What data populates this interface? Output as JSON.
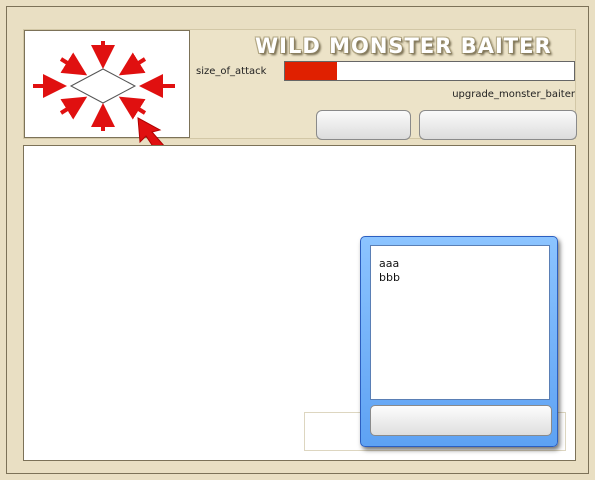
{
  "header": {
    "title": "WILD MONSTER BAITER",
    "size_label": "size_of_attack",
    "attack_progress": 0.18,
    "progress_color": "#e02000",
    "upgrade_label": "upgrade_monster_baiter"
  },
  "icon": {
    "name": "shrink-area-icon",
    "pointer": "cursor-arrow-icon"
  },
  "popup": {
    "items": [
      "aaa",
      "bbb"
    ]
  }
}
